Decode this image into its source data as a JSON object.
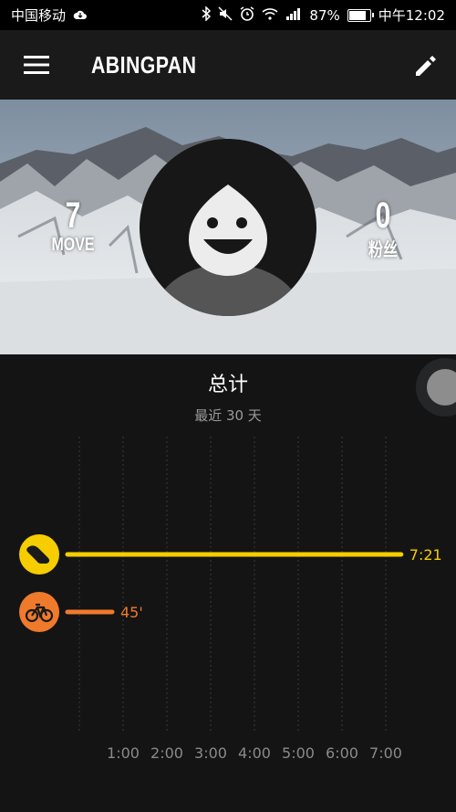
{
  "status_bar": {
    "carrier": "中国移动",
    "battery_text": "87%",
    "time": "中午12:02",
    "battery_level": 0.87,
    "icons": [
      "cloud-icon",
      "bluetooth-icon",
      "mute-icon",
      "alarm-icon",
      "wifi-icon",
      "signal-icon",
      "battery-icon"
    ]
  },
  "app_bar": {
    "title": "ABINGPAN",
    "menu_icon": "hamburger-menu-icon",
    "edit_icon": "pencil-edit-icon"
  },
  "profile": {
    "left_stat": {
      "value": "7",
      "label": "MOVE"
    },
    "right_stat": {
      "value": "0",
      "label": "粉丝"
    },
    "avatar_icon": "smiling-drop-avatar-icon"
  },
  "summary": {
    "title": "总计",
    "subtitle": "最近 30 天"
  },
  "chart_data": {
    "type": "bar",
    "orientation": "horizontal",
    "x_unit": "hours",
    "x_ticks": [
      "1:00",
      "2:00",
      "3:00",
      "4:00",
      "5:00",
      "6:00",
      "7:00"
    ],
    "x_tick_values": [
      1,
      2,
      3,
      4,
      5,
      6,
      7
    ],
    "grid": true,
    "series": [
      {
        "name": "running",
        "icon": "running-shoe-icon",
        "value_hours": 7.35,
        "label": "7:21",
        "color": "#f5cd00"
      },
      {
        "name": "cycling",
        "icon": "bicycle-icon",
        "value_hours": 0.75,
        "label": "45'",
        "color": "#f07a2c"
      }
    ]
  },
  "colors": {
    "background": "#141414",
    "app_bar": "#1a1a1a",
    "running": "#f5cd00",
    "cycling": "#f07a2c"
  }
}
